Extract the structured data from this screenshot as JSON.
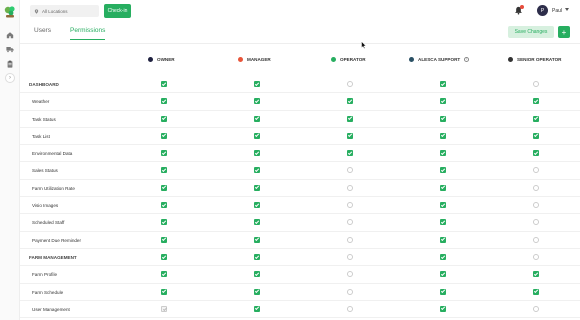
{
  "topbar": {
    "location_placeholder": "All Locations",
    "checkin_label": "Check-in",
    "user_initial": "P",
    "user_name": "Paul"
  },
  "tabs": [
    {
      "label": "Users",
      "active": false
    },
    {
      "label": "Permissions",
      "active": true
    }
  ],
  "actions": {
    "save_label": "Save Changes",
    "add_label": "+"
  },
  "roles": [
    {
      "name": "OWNER",
      "color": "#1f2140"
    },
    {
      "name": "MANAGER",
      "color": "#e8553a"
    },
    {
      "name": "OPERATOR",
      "color": "#27ae60"
    },
    {
      "name": "ALESCA SUPPORT",
      "color": "#2a5064",
      "info": "i"
    },
    {
      "name": "SENIOR OPERATOR",
      "color": "#333333"
    }
  ],
  "permissions": [
    {
      "label": "DASHBOARD",
      "section": true,
      "values": [
        "on",
        "on",
        "off",
        "on",
        "off"
      ]
    },
    {
      "label": "Weather",
      "section": false,
      "values": [
        "on",
        "on",
        "on",
        "on",
        "on"
      ]
    },
    {
      "label": "Task Status",
      "section": false,
      "values": [
        "on",
        "on",
        "on",
        "on",
        "on"
      ]
    },
    {
      "label": "Task List",
      "section": false,
      "values": [
        "on",
        "on",
        "on",
        "on",
        "on"
      ]
    },
    {
      "label": "Environmental Data",
      "section": false,
      "values": [
        "on",
        "on",
        "on",
        "on",
        "on"
      ]
    },
    {
      "label": "Sales Status",
      "section": false,
      "values": [
        "on",
        "on",
        "off",
        "on",
        "off"
      ]
    },
    {
      "label": "Farm Utilization Rate",
      "section": false,
      "values": [
        "on",
        "on",
        "off",
        "on",
        "off"
      ]
    },
    {
      "label": "Visio Images",
      "section": false,
      "values": [
        "on",
        "on",
        "off",
        "on",
        "off"
      ]
    },
    {
      "label": "Scheduled Staff",
      "section": false,
      "values": [
        "on",
        "on",
        "off",
        "on",
        "off"
      ]
    },
    {
      "label": "Payment Due Reminder",
      "section": false,
      "values": [
        "on",
        "on",
        "off",
        "on",
        "off"
      ]
    },
    {
      "label": "FARM MANAGEMENT",
      "section": true,
      "values": [
        "on",
        "on",
        "off",
        "on",
        "off"
      ]
    },
    {
      "label": "Farm Profile",
      "section": false,
      "values": [
        "on",
        "on",
        "off",
        "on",
        "on"
      ]
    },
    {
      "label": "Farm Schedule",
      "section": false,
      "values": [
        "on",
        "on",
        "off",
        "on",
        "on"
      ]
    },
    {
      "label": "User Management",
      "section": false,
      "values": [
        "disabled",
        "on",
        "off",
        "on",
        "off"
      ]
    }
  ],
  "colors": {
    "accent": "#27ae60",
    "save_bg": "#d7f0df"
  },
  "icons": {
    "sidebar": [
      "home-icon",
      "truck-icon",
      "clipboard-icon"
    ],
    "collapse": "chevron-right-icon"
  }
}
